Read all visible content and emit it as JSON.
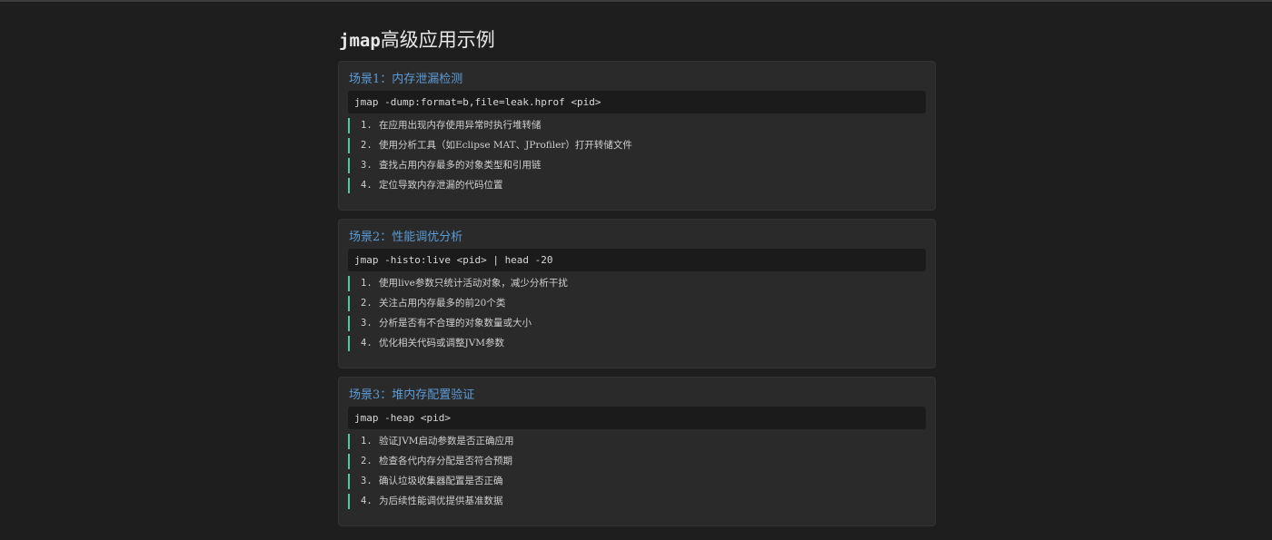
{
  "page": {
    "title_code": "jmap",
    "title_rest": "高级应用示例"
  },
  "scenarios": [
    {
      "title": "场景1：内存泄漏检测",
      "command": "jmap -dump:format=b,file=leak.hprof <pid>",
      "steps": [
        {
          "num": "1.",
          "text": "在应用出现内存使用异常时执行堆转储"
        },
        {
          "num": "2.",
          "text": "使用分析工具（如Eclipse MAT、JProfiler）打开转储文件"
        },
        {
          "num": "3.",
          "text": "查找占用内存最多的对象类型和引用链"
        },
        {
          "num": "4.",
          "text": "定位导致内存泄漏的代码位置"
        }
      ]
    },
    {
      "title": "场景2：性能调优分析",
      "command": "jmap -histo:live <pid> | head -20",
      "steps": [
        {
          "num": "1.",
          "text": "使用live参数只统计活动对象，减少分析干扰"
        },
        {
          "num": "2.",
          "text": "关注占用内存最多的前20个类"
        },
        {
          "num": "3.",
          "text": "分析是否有不合理的对象数量或大小"
        },
        {
          "num": "4.",
          "text": "优化相关代码或调整JVM参数"
        }
      ]
    },
    {
      "title": "场景3：堆内存配置验证",
      "command": "jmap -heap <pid>",
      "steps": [
        {
          "num": "1.",
          "text": "验证JVM启动参数是否正确应用"
        },
        {
          "num": "2.",
          "text": "检查各代内存分配是否符合预期"
        },
        {
          "num": "3.",
          "text": "确认垃圾收集器配置是否正确"
        },
        {
          "num": "4.",
          "text": "为后续性能调优提供基准数据"
        }
      ]
    }
  ],
  "colors": {
    "background": "#1e1e1e",
    "card": "#2a2a2a",
    "code_bg": "#1b1b1b",
    "scenario_title": "#5b9bd5",
    "step_accent": "#4ec9a0"
  }
}
